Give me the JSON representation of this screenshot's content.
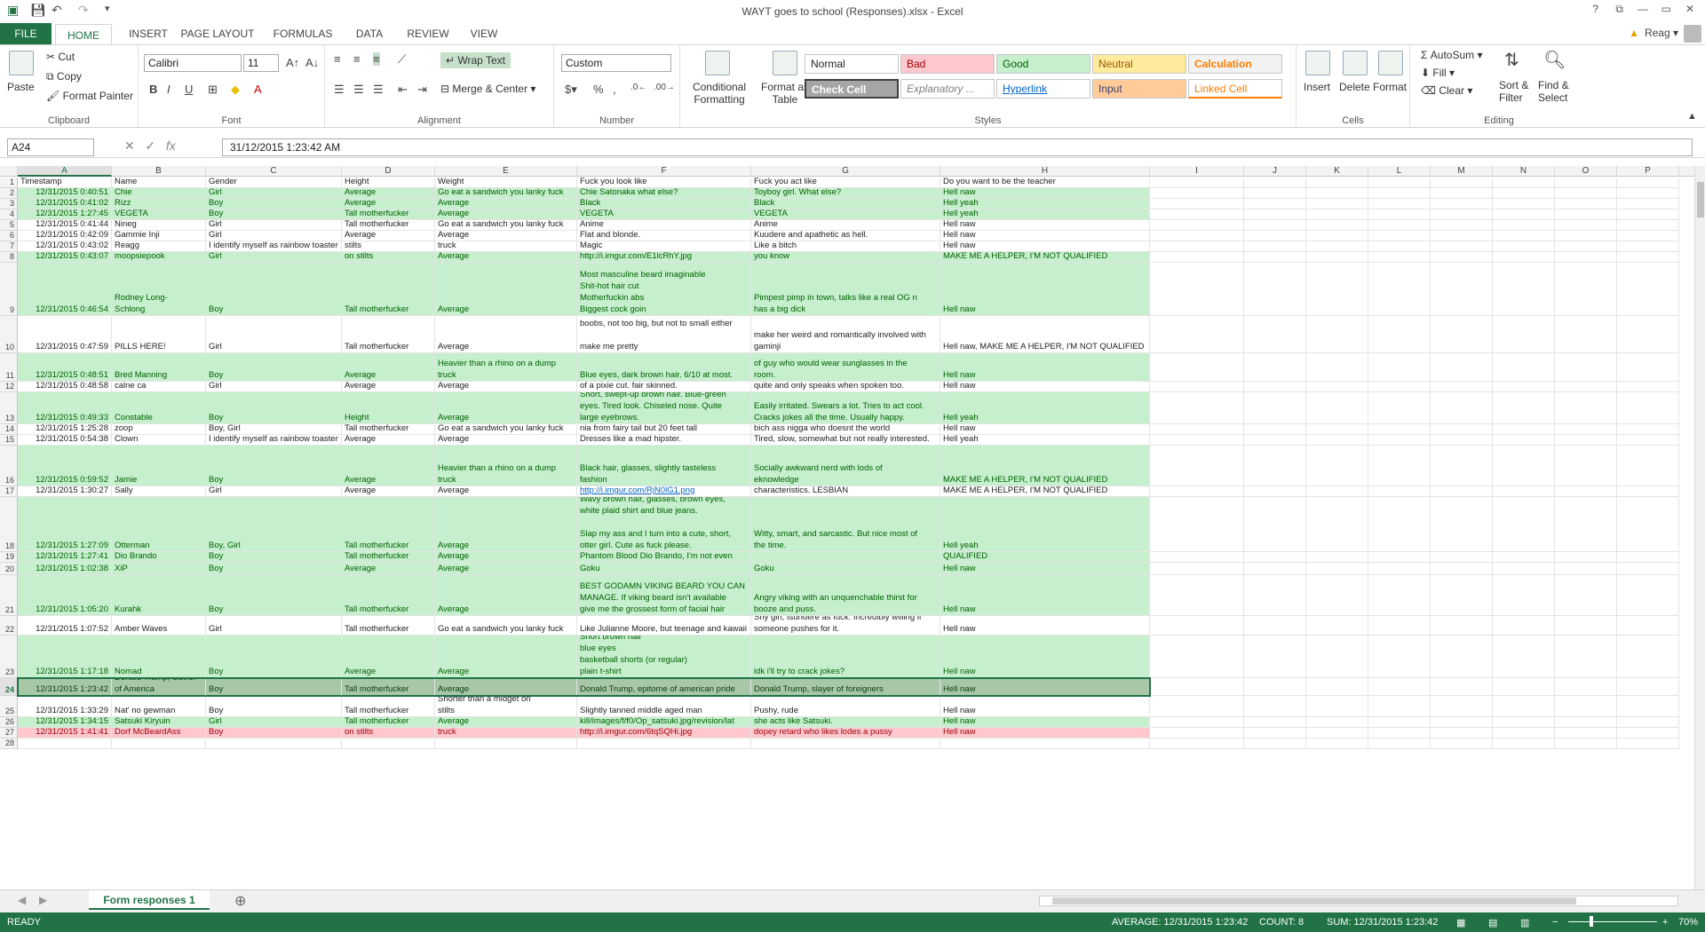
{
  "window": {
    "title": "WAYT goes to school (Responses).xlsx - Excel",
    "help": "?",
    "min": "—",
    "max": "▭",
    "close": "✕",
    "restore": "⧉"
  },
  "tabs": [
    "FILE",
    "HOME",
    "INSERT",
    "PAGE LAYOUT",
    "FORMULAS",
    "DATA",
    "REVIEW",
    "VIEW"
  ],
  "user": "Reag",
  "ribbon": {
    "clipboard": {
      "paste": "Paste",
      "cut": "Cut",
      "copy": "Copy",
      "painter": "Format Painter",
      "label": "Clipboard"
    },
    "font": {
      "name": "Calibri",
      "size": "11",
      "label": "Font",
      "bold": "B",
      "italic": "I",
      "underline": "U"
    },
    "alignment": {
      "wrap": "Wrap Text",
      "merge": "Merge & Center",
      "label": "Alignment"
    },
    "number": {
      "format": "Custom",
      "label": "Number",
      "pct": "%",
      "comma": ","
    },
    "cond": {
      "l1": "Conditional",
      "l2": "Formatting"
    },
    "fat": {
      "l1": "Format as",
      "l2": "Table"
    },
    "styles": {
      "label": "Styles",
      "normal": "Normal",
      "bad": "Bad",
      "good": "Good",
      "neutral": "Neutral",
      "calc": "Calculation",
      "check": "Check Cell",
      "expl": "Explanatory ...",
      "hyper": "Hyperlink",
      "input": "Input",
      "linked": "Linked Cell"
    },
    "cells": {
      "insert": "Insert",
      "delete": "Delete",
      "format": "Format",
      "label": "Cells"
    },
    "editing": {
      "autosum": "AutoSum",
      "fill": "Fill",
      "clear": "Clear",
      "sort1": "Sort &",
      "sort2": "Filter",
      "find1": "Find &",
      "find2": "Select",
      "label": "Editing"
    }
  },
  "formula_bar": {
    "name_box": "A24",
    "formula": "31/12/2015  1:23:42 AM",
    "fx": "fx"
  },
  "columns": [
    "A",
    "B",
    "C",
    "D",
    "E",
    "F",
    "G",
    "H",
    "I",
    "J",
    "K",
    "L",
    "M",
    "N",
    "O",
    "P"
  ],
  "rows": [
    {
      "n": "1",
      "style": "white",
      "cells": [
        "Timestamp",
        "Name",
        "Gender",
        "Height",
        "Weight",
        "Fuck you look like",
        "Fuck you act like",
        "Do you want to be the teacher"
      ]
    },
    {
      "n": "2",
      "style": "green",
      "cells": [
        "12/31/2015 0:40:51",
        "Chie",
        "Girl",
        "Average",
        "Go eat a sandwich you lanky fuck",
        "Chie Satonaka what else?",
        "Toyboy girl. What else?",
        "Hell naw"
      ]
    },
    {
      "n": "3",
      "style": "green",
      "cells": [
        "12/31/2015 0:41:02",
        "Rizz",
        "Boy",
        "Average",
        "Average",
        "Black",
        "Black",
        "Hell yeah"
      ]
    },
    {
      "n": "4",
      "style": "green",
      "cells": [
        "12/31/2015 1:27:45",
        "VEGETA",
        "Boy",
        "Tall motherfucker",
        "Average",
        "VEGETA",
        "VEGETA",
        "Hell yeah"
      ]
    },
    {
      "n": "5",
      "style": "white",
      "cells": [
        "12/31/2015 0:41:44",
        "Nineg",
        "Girl",
        "Tall motherfucker",
        "Go eat a sandwich you lanky fuck",
        "Anime",
        "Anime",
        "Hell naw"
      ]
    },
    {
      "n": "6",
      "style": "white",
      "cells": [
        "12/31/2015 0:42:09",
        "Gammie Inji",
        "Girl",
        "Average",
        "Average",
        "Flat and blonde.",
        "Kuudere and apathetic as hell.",
        "Hell naw"
      ]
    },
    {
      "n": "7",
      "style": "white",
      "cells": [
        "12/31/2015 0:43:02",
        "Reagg",
        "I identify myself as rainbow toaster",
        "stilts",
        "Heavier than a rhino on a dump truck",
        "Magic",
        "Like a bitch",
        "Hell naw"
      ]
    },
    {
      "n": "8",
      "style": "green",
      "cells": [
        "12/31/2015 0:43:07",
        "moopsiepook",
        "Girl",
        "on stilts",
        "Average",
        "http://i.imgur.com/E1lcRhY.jpg",
        "you know",
        "MAKE ME A HELPER, I'M NOT QUALIFIED"
      ]
    },
    {
      "n": "9",
      "style": "green",
      "cells": [
        "12/31/2015 0:46:54",
        "Rodney Long-\nSchlong",
        "Boy",
        "Tall motherfucker",
        "Average",
        "Most masculine beard imaginable\nShit-hot hair cut\nMotherfuckin abs\nBiggest cock goin",
        "Pimpest pimp in town, talks like a real OG n\nhas a big dick",
        "Hell naw"
      ]
    },
    {
      "n": "10",
      "style": "white",
      "cells": [
        "12/31/2015 0:47:59",
        "PILLS HERE!",
        "Girl",
        "Tall motherfucker",
        "Average",
        "brunette\nboobs, not too big, but not to small either\n\nmake me pretty",
        "pill is pill\n\nmake her weird and romantically involved with\ngaminji",
        "Hell naw, MAKE ME A HELPER, I'M NOT QUALIFIED"
      ]
    },
    {
      "n": "11",
      "style": "green",
      "cells": [
        "12/31/2015 0:48:51",
        "Bred Manning",
        "Boy",
        "Average",
        "Heavier than a rhino on a dump\ntruck",
        "Blue eyes, dark brown hair. 6/10 at most.",
        "of guy who would wear sunglasses in the\nroom.",
        "Hell naw"
      ]
    },
    {
      "n": "12",
      "style": "white",
      "cells": [
        "12/31/2015 0:48:58",
        "calne ca",
        "Girl",
        "Average",
        "Average",
        "of a pixie cut. fair skinned.",
        "quite and only speaks when spoken too.",
        "Hell naw"
      ]
    },
    {
      "n": "13",
      "style": "green",
      "cells": [
        "12/31/2015 0:49:33",
        "Constable",
        "Boy",
        "Height",
        "Average",
        "Short, swept-up brown hair. Blue-green\neyes. Tired look. Chiseled nose. Quite\nlarge eyebrows.",
        "Easily irritated. Swears a lot. Tries to act cool.\nCracks jokes all the time. Usually happy.",
        "Hell yeah"
      ]
    },
    {
      "n": "14",
      "style": "white",
      "cells": [
        "12/31/2015 1:25:28",
        "zoop",
        "Boy, Girl",
        "Tall motherfucker",
        "Go eat a sandwich you lanky fuck",
        "nia from fairy tail but 20 feet tall",
        "bich ass nigga who doesnt the world",
        "Hell naw"
      ]
    },
    {
      "n": "15",
      "style": "white",
      "cells": [
        "12/31/2015 0:54:38",
        "Clown",
        "I identify myself as rainbow toaster",
        "Average",
        "Average",
        "Dresses like a mad hipster.",
        "Tired, slow, somewhat but not really interested.",
        "Hell yeah"
      ]
    },
    {
      "n": "16",
      "style": "green",
      "cells": [
        "12/31/2015 0:59:52",
        "Jamie",
        "Boy",
        "Average",
        "Heavier than a rhino on a dump\ntruck",
        "Black hair, glasses, slightly tasteless\nfashion",
        "Socially awkward nerd with lods of\neknowledge",
        "MAKE ME A HELPER, I'M NOT QUALIFIED"
      ]
    },
    {
      "n": "17",
      "style": "white",
      "cells": [
        "12/31/2015 1:30:27",
        "Sally",
        "Girl",
        "Average",
        "Average",
        "http://i.imgur.com/RjN0lG1.png",
        "characteristics. LESBIAN",
        "MAKE ME A HELPER, I'M NOT QUALIFIED"
      ]
    },
    {
      "n": "18",
      "style": "green",
      "cells": [
        "12/31/2015 1:27:09",
        "Otterman",
        "Boy, Girl",
        "Tall motherfucker",
        "Average",
        "Wavy brown hair, glasses, brown eyes,\nwhite plaid shirt and blue jeans.\n\nSlap my ass and I turn into a cute, short,\notter girl. Cute as fuck please.",
        "Witty, smart, and sarcastic. But nice most of\nthe time.",
        "Hell yeah"
      ]
    },
    {
      "n": "19",
      "style": "green",
      "cells": [
        "12/31/2015 1:27:41",
        "Dio Brando",
        "Boy",
        "Tall motherfucker",
        "Average",
        "Phantom Blood Dio Brando, I'm not even",
        "",
        "QUALIFIED"
      ]
    },
    {
      "n": "20",
      "style": "green",
      "cells": [
        "12/31/2015 1:02:38",
        "XiP",
        "Boy",
        "Average",
        "Average",
        "Goku",
        "Goku",
        "Hell naw"
      ]
    },
    {
      "n": "21",
      "style": "green",
      "cells": [
        "12/31/2015 1:05:20",
        "Kurahk",
        "Boy",
        "Tall motherfucker",
        "Average",
        "BEST GODAMN VIKING BEARD YOU CAN\nMANAGE. If viking beard isn't available\ngive me the grossest form of facial hair",
        "Angry viking with an unquenchable thirst for\nbooze and puss.",
        "Hell naw"
      ]
    },
    {
      "n": "22",
      "style": "white",
      "cells": [
        "12/31/2015 1:07:52",
        "Amber Waves",
        "Girl",
        "Tall motherfucker",
        "Go eat a sandwich you lanky fuck",
        "Like Julianne Moore, but teenage and kawaii",
        "Shy girl, tsundere as fuck. Incredibly willing if\nsomeone pushes for it.",
        "Hell naw"
      ]
    },
    {
      "n": "23",
      "style": "green",
      "cells": [
        "12/31/2015 1:17:18",
        "Nomad",
        "Boy",
        "Average",
        "Average",
        "Short brown hair\nblue eyes\nbasketball shorts (or regular)\nplain t-shirt",
        "idk i'll try to crack jokes?",
        "Hell naw"
      ]
    },
    {
      "n": "24",
      "style": "sel",
      "cells": [
        "12/31/2015 1:23:42",
        "Donald Trump, Savior\nof America",
        "Boy",
        "Tall motherfucker",
        "Average",
        "Donald Trump, epitome of american pride",
        "Donald Trump, slayer of foreigners",
        "Hell naw"
      ]
    },
    {
      "n": "25",
      "style": "white",
      "cells": [
        "12/31/2015 1:33:29",
        "Nat' no gewman",
        "Boy",
        "Tall motherfucker",
        "Shorter than a midget on\nstilts",
        "Slightly tanned middle aged man",
        "Pushy, rude",
        "Hell naw"
      ]
    },
    {
      "n": "26",
      "style": "green",
      "cells": [
        "12/31/2015 1:34:15",
        "Satsuki Kiryuin",
        "Girl",
        "Tall motherfucker",
        "Average",
        "kill/images/f/f0/Op_satsuki.jpg/revision/lat",
        "she acts like Satsuki.",
        "Hell naw"
      ]
    },
    {
      "n": "27",
      "style": "pink",
      "cells": [
        "12/31/2015 1:41:41",
        "Dorf McBeardAss",
        "Boy",
        "on stilts",
        "truck",
        "http://i.imgur.com/6tqSQHi.jpg",
        "dopey retard who likes lodes a pussy",
        "Hell naw"
      ]
    },
    {
      "n": "28",
      "style": "white",
      "cells": [
        "",
        "",
        "",
        "",
        "",
        "",
        "",
        ""
      ]
    }
  ],
  "sheet_tab": "Form responses 1",
  "status": {
    "ready": "READY",
    "average": "AVERAGE: 12/31/2015 1:23:42",
    "count": "COUNT: 8",
    "sum": "SUM: 12/31/2015 1:23:42",
    "zoom": "70%"
  }
}
